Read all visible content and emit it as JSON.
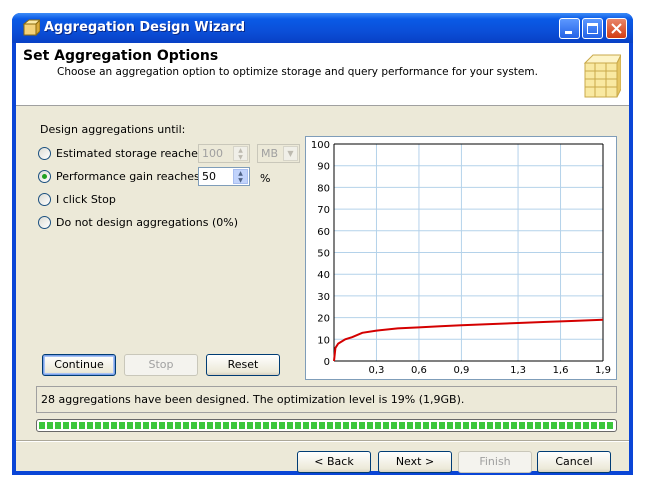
{
  "window": {
    "title": "Aggregation Design Wizard"
  },
  "header": {
    "title": "Set Aggregation Options",
    "subtitle": "Choose an aggregation option to optimize storage and query performance for your system."
  },
  "options": {
    "group_label": "Design aggregations until:",
    "items": [
      {
        "label": "Estimated storage reaches",
        "selected": false
      },
      {
        "label": "Performance gain reaches",
        "selected": true
      },
      {
        "label": "I click Stop",
        "selected": false
      },
      {
        "label": "Do not design aggregations (0%)",
        "selected": false
      }
    ],
    "storage_value": "100",
    "storage_unit": "MB",
    "gain_value": "50",
    "gain_unit": "%"
  },
  "actions": {
    "continue": "Continue",
    "stop": "Stop",
    "reset": "Reset"
  },
  "status": {
    "message": "28 aggregations have been designed. The optimization level is 19% (1,9GB).",
    "progress": 1.0
  },
  "footer": {
    "back": "< Back",
    "next": "Next >",
    "finish": "Finish",
    "cancel": "Cancel"
  },
  "chart_data": {
    "type": "line",
    "title": "",
    "xlabel": "",
    "ylabel": "",
    "ylim": [
      0,
      100
    ],
    "xlim": [
      0,
      1.9
    ],
    "yticks": [
      "0",
      "10",
      "20",
      "30",
      "40",
      "50",
      "60",
      "70",
      "80",
      "90",
      "100"
    ],
    "xticks": [
      "0,3",
      "0,6",
      "0,9",
      "1,3",
      "1,6",
      "1,9"
    ],
    "xtick_values": [
      0.3,
      0.6,
      0.9,
      1.3,
      1.6,
      1.9
    ],
    "grid": true,
    "series": [
      {
        "color": "#d40000",
        "x": [
          0,
          0.01,
          0.03,
          0.08,
          0.13,
          0.2,
          0.3,
          0.45,
          0.6,
          0.75,
          0.9,
          1.1,
          1.3,
          1.5,
          1.7,
          1.9
        ],
        "y": [
          0,
          6,
          8,
          10,
          11,
          13,
          14,
          15,
          15.5,
          16,
          16.5,
          17,
          17.5,
          18,
          18.5,
          19
        ]
      }
    ]
  }
}
